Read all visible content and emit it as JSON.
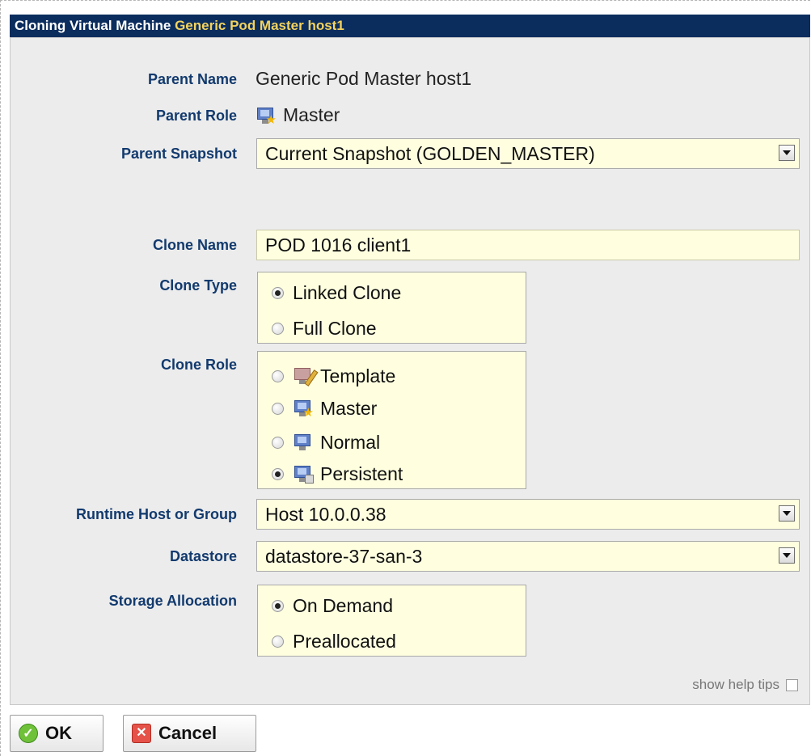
{
  "window": {
    "title_prefix": "Cloning Virtual Machine",
    "title_name": "Generic Pod Master host1"
  },
  "parent": {
    "name_label": "Parent Name",
    "name_value": "Generic Pod Master host1",
    "role_label": "Parent Role",
    "role_value": "Master",
    "snapshot_label": "Parent Snapshot",
    "snapshot_value": "Current Snapshot (GOLDEN_MASTER)"
  },
  "clone": {
    "name_label": "Clone Name",
    "name_value": "POD 1016 client1",
    "type_label": "Clone Type",
    "type_options": [
      {
        "label": "Linked Clone",
        "checked": true
      },
      {
        "label": "Full Clone",
        "checked": false
      }
    ],
    "role_label": "Clone Role",
    "role_options": [
      {
        "label": "Template",
        "icon": "template-icon",
        "checked": false
      },
      {
        "label": "Master",
        "icon": "master-icon",
        "checked": false
      },
      {
        "label": "Normal",
        "icon": "normal-icon",
        "checked": false
      },
      {
        "label": "Persistent",
        "icon": "persistent-icon",
        "checked": true
      }
    ]
  },
  "runtime": {
    "host_label": "Runtime Host or Group",
    "host_value": "Host 10.0.0.38",
    "datastore_label": "Datastore",
    "datastore_value": "datastore-37-san-3",
    "storage_label": "Storage Allocation",
    "storage_options": [
      {
        "label": "On Demand",
        "checked": true
      },
      {
        "label": "Preallocated",
        "checked": false
      }
    ]
  },
  "help": {
    "label": "show help tips",
    "checked": false
  },
  "buttons": {
    "ok": "OK",
    "cancel": "Cancel"
  }
}
